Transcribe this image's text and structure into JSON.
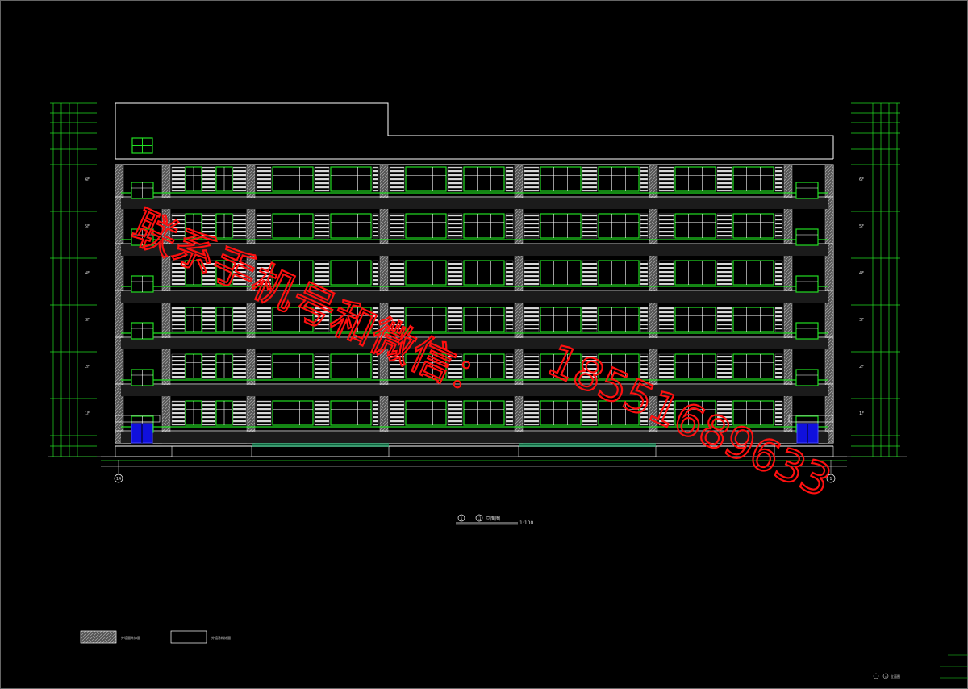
{
  "drawing": {
    "title_code": "1",
    "title_code2": "11",
    "title_text": "立面图",
    "scale": "1:100",
    "axis_left": "14",
    "axis_right": "1",
    "floor_labels_left": [
      "6F",
      "5F",
      "4F",
      "3F",
      "2F",
      "1F"
    ],
    "floor_labels_right": [
      "6F",
      "5F",
      "4F",
      "3F",
      "2F",
      "1F"
    ],
    "legend": [
      {
        "name": "hatched",
        "text": "外墙面砖饰面"
      },
      {
        "name": "plain",
        "text": "外墙涂料饰面"
      }
    ],
    "corner_code": "1",
    "corner_text": "立面图"
  },
  "watermark": {
    "line1": "联系手机号和微信：",
    "line2": "18551689633"
  },
  "colors": {
    "background": "#000000",
    "lines": "#ffffff",
    "windows": "#22dd22",
    "doors": "#1010dd",
    "watermark": "#ff1010"
  }
}
